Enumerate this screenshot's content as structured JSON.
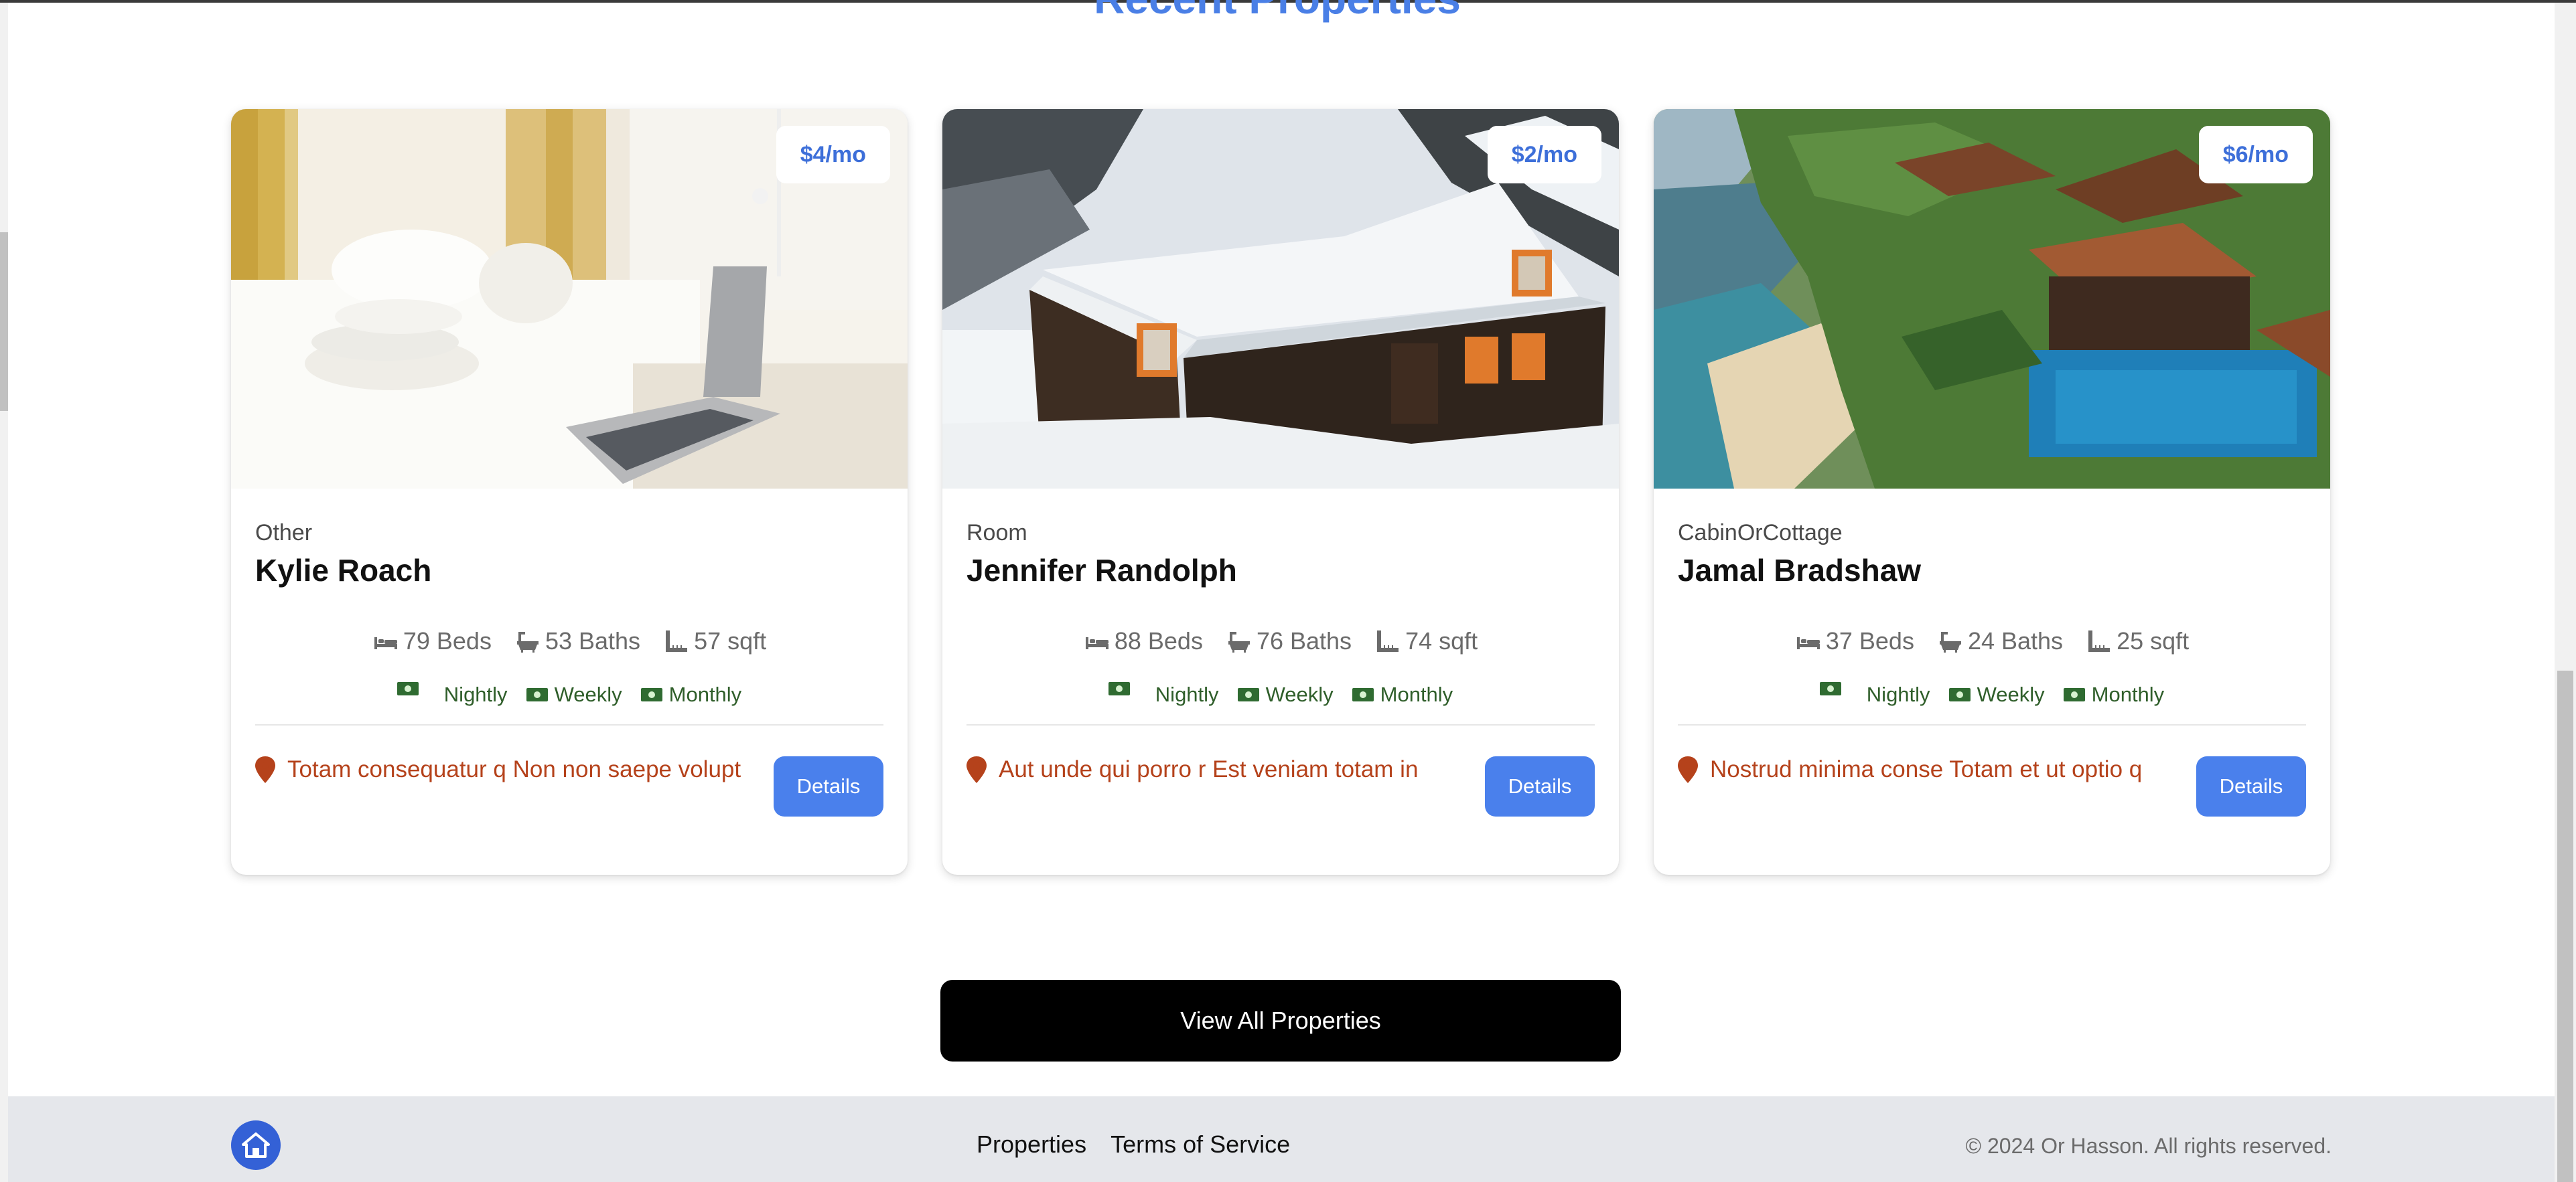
{
  "section": {
    "title": "Recent Properties"
  },
  "properties": [
    {
      "price": "$4/mo",
      "type": "Other",
      "name": "Kylie Roach",
      "beds": "79 Beds",
      "baths": "53 Baths",
      "sqft": "57 sqft",
      "rates": [
        "Nightly",
        "Weekly",
        "Monthly"
      ],
      "location": "Totam consequatur q Non non saepe volupt",
      "details_label": "Details",
      "image": "bedroom-with-laptop"
    },
    {
      "price": "$2/mo",
      "type": "Room",
      "name": "Jennifer Randolph",
      "beds": "88 Beds",
      "baths": "76 Baths",
      "sqft": "74 sqft",
      "rates": [
        "Nightly",
        "Weekly",
        "Monthly"
      ],
      "location": "Aut unde qui porro r Est veniam totam in",
      "details_label": "Details",
      "image": "snowy-chalet"
    },
    {
      "price": "$6/mo",
      "type": "CabinOrCottage",
      "name": "Jamal Bradshaw",
      "beds": "37 Beds",
      "baths": "24 Baths",
      "sqft": "25 sqft",
      "rates": [
        "Nightly",
        "Weekly",
        "Monthly"
      ],
      "location": "Nostrud minima conse Totam et ut optio q",
      "details_label": "Details",
      "image": "coastal-resort"
    }
  ],
  "view_all_label": "View All Properties",
  "footer": {
    "links": [
      "Properties",
      "Terms of Service"
    ],
    "copyright": "© 2024 Or Hasson. All rights reserved.",
    "logo_icon": "house-icon"
  },
  "colors": {
    "accent": "#4a80ec",
    "title": "#4a7fe6",
    "location": "#b5421b",
    "rate_text": "#2f5e2a",
    "footer_bg": "#e5e7eb"
  },
  "icons": {
    "beds": "bed-icon",
    "baths": "bath-icon",
    "sqft": "ruler-icon",
    "rates": "cash-icon",
    "location": "map-pin-icon"
  }
}
